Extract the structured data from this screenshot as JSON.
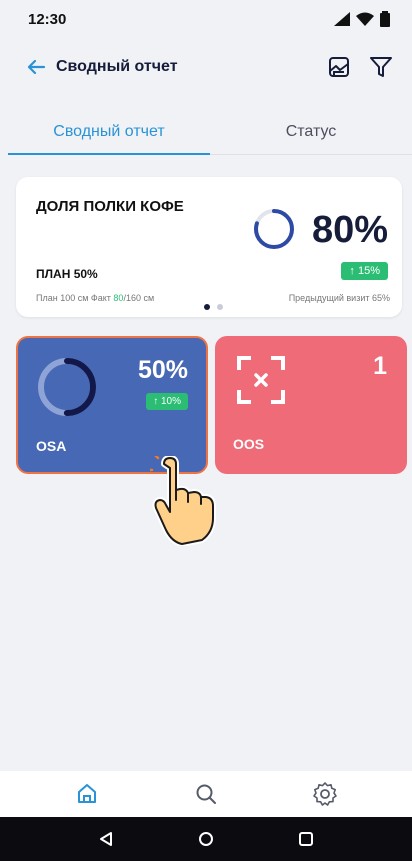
{
  "status_bar": {
    "time": "12:30"
  },
  "app_bar": {
    "title": "Сводный отчет"
  },
  "tabs": [
    {
      "label": "Сводный отчет",
      "active": true
    },
    {
      "label": "Статус",
      "active": false
    }
  ],
  "summary_card": {
    "heading": "ДОЛЯ ПОЛКИ КОФЕ",
    "percent": "80%",
    "percent_value": 0.8,
    "plan": "ПЛАН 50%",
    "delta": "↑ 15%",
    "footer_prefix": "План 100 см Факт ",
    "footer_fact": "80",
    "footer_suffix": "/160 см",
    "previous_visit": "Предыдущий визит 65%",
    "pager": {
      "count": 2,
      "active_index": 0
    }
  },
  "tiles": {
    "osa": {
      "label": "OSA",
      "percent": "50%",
      "percent_value": 0.5,
      "delta": "↑ 10%"
    },
    "oos": {
      "label": "OOS",
      "count": "1"
    }
  },
  "colors": {
    "accent": "#2a93d5",
    "dark_text": "#161d3a",
    "positive": "#2bbd73",
    "osa_tile": "#4768b4",
    "osa_border": "#ef7444",
    "oos_tile": "#ee6b77"
  },
  "icons": {
    "back": "arrow-left-icon",
    "gallery": "gallery-icon",
    "filter": "filter-icon",
    "home": "home-icon",
    "search": "search-icon",
    "settings": "gear-icon"
  }
}
